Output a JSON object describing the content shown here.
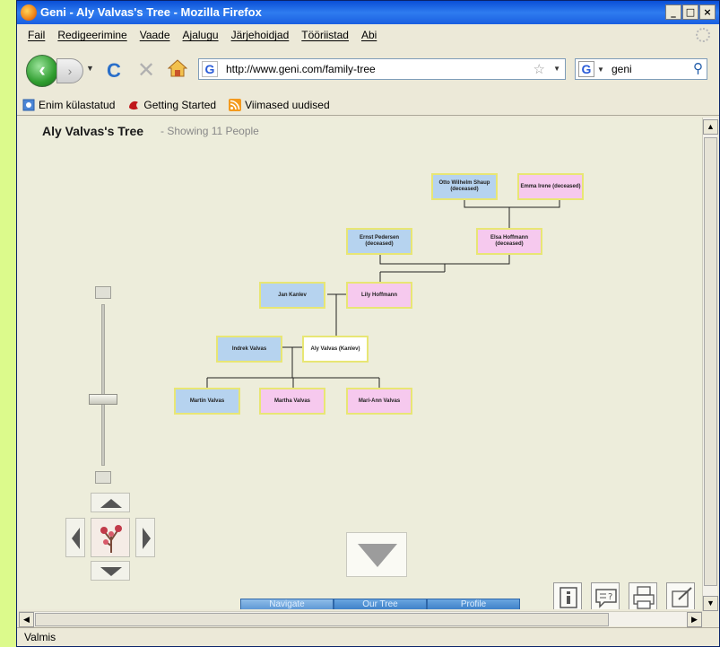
{
  "window": {
    "title": "Geni - Aly Valvas's Tree - Mozilla Firefox",
    "controls": {
      "minimize": "_",
      "maximize": "□",
      "close": "×"
    }
  },
  "menubar": {
    "items": [
      {
        "label": "Fail"
      },
      {
        "label": "Redigeerimine"
      },
      {
        "label": "Vaade"
      },
      {
        "label": "Ajalugu"
      },
      {
        "label": "Järjehoidjad"
      },
      {
        "label": "Tööriistad"
      },
      {
        "label": "Abi"
      }
    ]
  },
  "navbar": {
    "url": "http://www.geni.com/family-tree",
    "search_value": "geni",
    "url_site_icon": "G",
    "search_engine_icon": "G"
  },
  "bookmarks": [
    {
      "label": "Enim külastatud",
      "icon": "most-visited-icon"
    },
    {
      "label": "Getting Started",
      "icon": "getting-started-icon"
    },
    {
      "label": "Viimased uudised",
      "icon": "rss-feed-icon"
    }
  ],
  "tree": {
    "title": "Aly Valvas's Tree",
    "subtitle": "- Showing 11 People",
    "people": {
      "great_grandfather": "Otto Wilhelm Shaup (deceased)",
      "great_grandmother": "Emma Irene (deceased)",
      "grandfather": "Ernst Pedersen (deceased)",
      "grandmother": "Elsa Hoffmann (deceased)",
      "father": "Jan Kanlev",
      "mother": "Lily Hoffmann",
      "spouse": "Indrek Valvas",
      "self": "Aly Valvas (Kanlev)",
      "child1": "Martin Valvas",
      "child2": "Martha Valvas",
      "child3": "Mari-Ann Valvas"
    }
  },
  "bottom_tabs": [
    {
      "label": "Navigate"
    },
    {
      "label": "Our Tree"
    },
    {
      "label": "Profile"
    }
  ],
  "status": {
    "text": "Valmis"
  }
}
